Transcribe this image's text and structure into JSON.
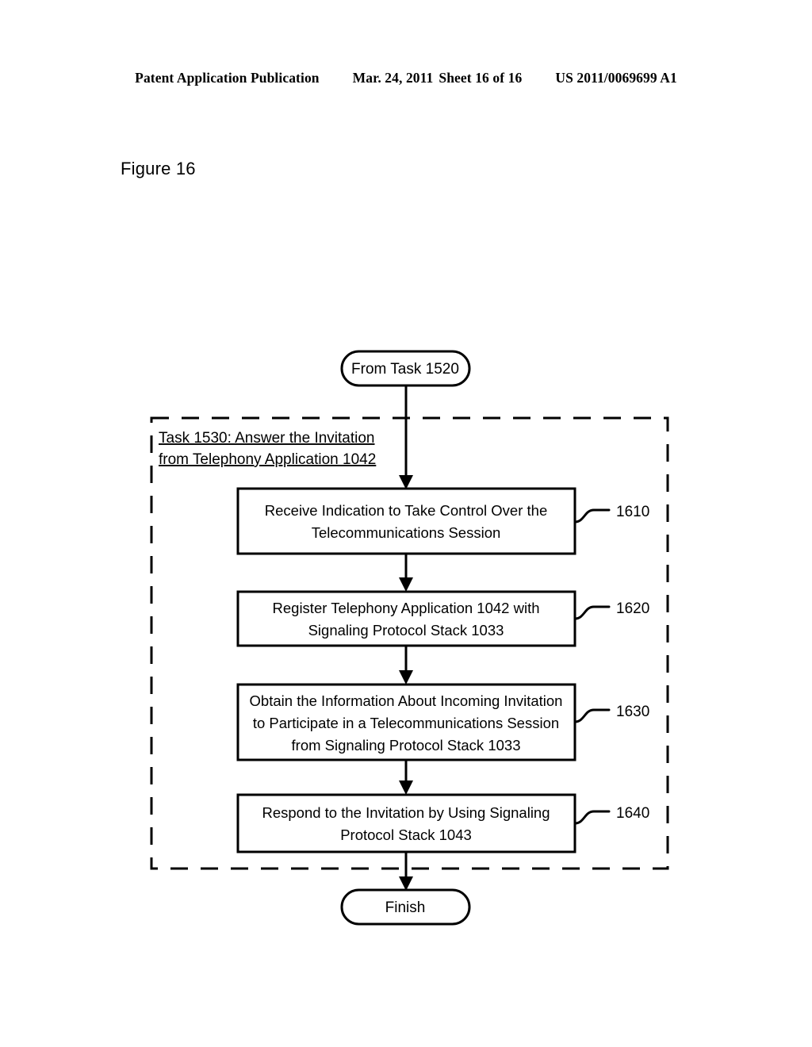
{
  "header": {
    "publication": "Patent Application Publication",
    "date": "Mar. 24, 2011",
    "sheet": "Sheet 16 of 16",
    "document_number": "US 2011/0069699 A1"
  },
  "figure": {
    "label": "Figure 16"
  },
  "diagram": {
    "start_node": "From Task 1520",
    "end_node": "Finish",
    "group": {
      "title_line_1": "Task 1530: Answer the Invitation",
      "title_line_2": "from Telephony Application 1042"
    },
    "steps": [
      {
        "ref": "1610",
        "lines": [
          "Receive Indication to Take Control Over the",
          "Telecommunications Session"
        ]
      },
      {
        "ref": "1620",
        "lines": [
          "Register Telephony Application 1042 with",
          "Signaling Protocol Stack 1033"
        ]
      },
      {
        "ref": "1630",
        "lines": [
          "Obtain the Information About Incoming Invitation",
          "to Participate in a Telecommunications Session",
          "from Signaling Protocol Stack 1033"
        ]
      },
      {
        "ref": "1640",
        "lines": [
          "Respond to the Invitation by Using Signaling",
          "Protocol Stack 1043"
        ]
      }
    ]
  }
}
